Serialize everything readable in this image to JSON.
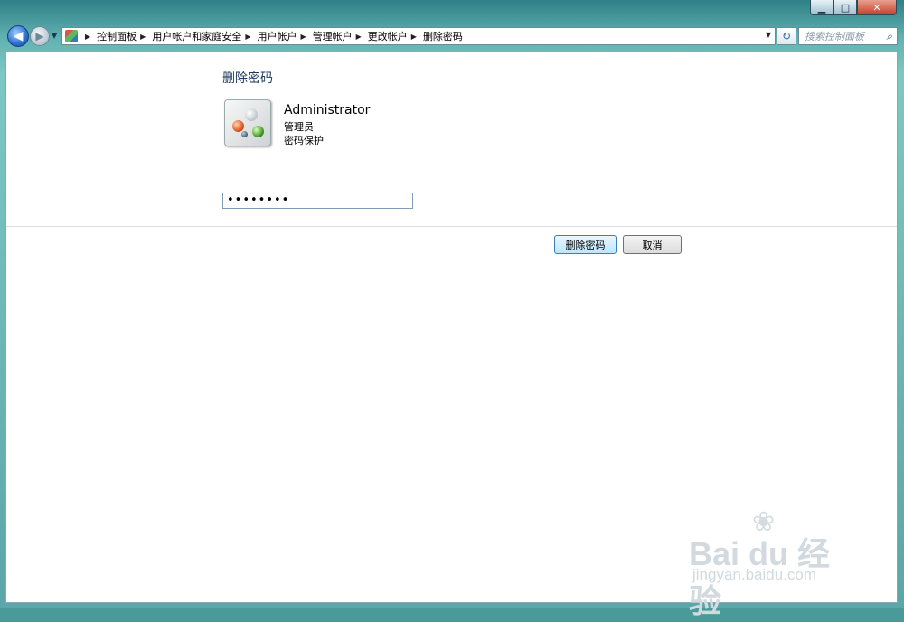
{
  "window": {
    "controls": {
      "minimize": "▁",
      "maximize": "□",
      "close": "✕"
    }
  },
  "nav": {
    "back_glyph": "◀",
    "forward_glyph": "▶",
    "history_glyph": "▼",
    "breadcrumbs": [
      "控制面板",
      "用户帐户和家庭安全",
      "用户帐户",
      "管理帐户",
      "更改帐户",
      "删除密码"
    ],
    "refresh_glyph": "↻",
    "search_placeholder": "搜索控制面板"
  },
  "main": {
    "title": "删除密码",
    "user": {
      "name": "Administrator",
      "role": "管理员",
      "status": "密码保护"
    },
    "password_value": "••••••••",
    "buttons": {
      "remove": "删除密码",
      "cancel": "取消"
    }
  },
  "watermark": {
    "brand": "Bai du 经验",
    "url": "jingyan.baidu.com"
  },
  "colors": {
    "title_text": "#1e395b",
    "frame": "#5fb0b0"
  }
}
